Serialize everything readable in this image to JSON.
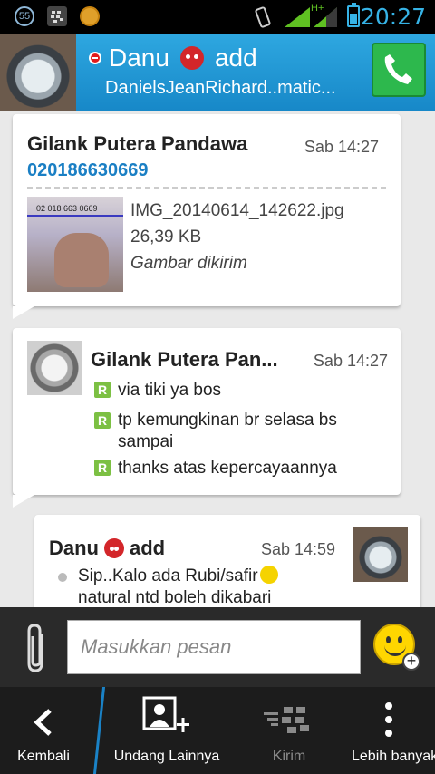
{
  "statusbar": {
    "time": "20:27",
    "notif_badge": "55",
    "network_type": "H+"
  },
  "header": {
    "name": "Danu",
    "name_suffix": "add",
    "subtitle": "DanielsJeanRichard..matic...",
    "call_icon": "phone-icon"
  },
  "messages": [
    {
      "sender": "Gilank Putera Pandawa",
      "phone": "020186630669",
      "time": "Sab 14:27",
      "file_name": "IMG_20140614_142622.jpg",
      "file_size": "26,39 KB",
      "file_status": "Gambar dikirim",
      "thumb_text": "02 018 663 0669"
    },
    {
      "sender": "Gilank Putera Pan...",
      "time": "Sab 14:27",
      "lines": [
        "via tiki ya bos",
        "tp kemungkinan br selasa bs sampai",
        "thanks atas kepercayaannya"
      ],
      "badge": "R"
    },
    {
      "sender_name": "Danu",
      "sender_suffix": "add",
      "time": "Sab 14:59",
      "line1": "Sip..Kalo ada Rubi/safir",
      "line2": "natural ntd boleh dikabari"
    }
  ],
  "compose": {
    "placeholder": "Masukkan pesan"
  },
  "nav": {
    "back": "Kembali",
    "invite": "Undang Lainnya",
    "send": "Kirim",
    "more": "Lebih banyak"
  }
}
